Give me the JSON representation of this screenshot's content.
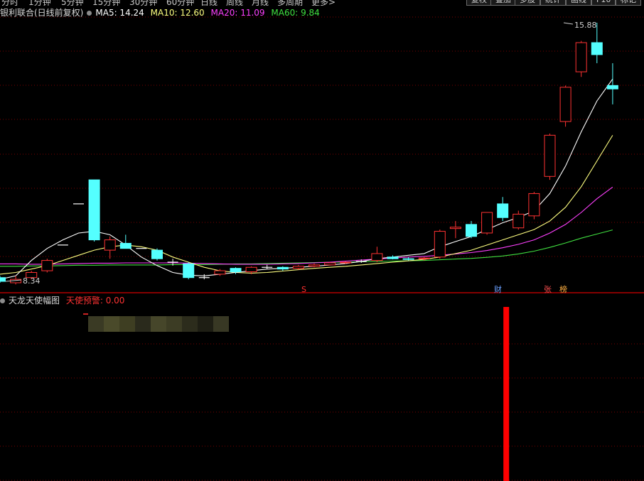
{
  "toolbar": {
    "period_tabs": [
      "分时",
      "1分钟",
      "5分钟",
      "15分钟",
      "30分钟",
      "60分钟",
      "日线",
      "周线",
      "月线",
      "多周期",
      "更多>"
    ],
    "buttons": [
      "复权",
      "叠加",
      "多股",
      "统计",
      "画线",
      "F10",
      "标记"
    ]
  },
  "main_header": {
    "title": "银利联合(日线前复权)",
    "ma5": "MA5: 14.24",
    "ma10": "MA10: 12.60",
    "ma20": "MA20: 11.09",
    "ma60": "MA60: 9.84"
  },
  "indicator_header": {
    "title": "天龙天使幅图",
    "signal": "天使预警: 0.00"
  },
  "chart_markers": {
    "high_label": "15.88",
    "low_label": "8.34",
    "event_s": "S",
    "event_cai": "财",
    "event_zhang": "张",
    "event_bang": "榜"
  },
  "colors": {
    "background": "#000000",
    "up": "#ff3232",
    "down": "#54ffff",
    "ma5": "#ffffff",
    "ma10": "#ffff80",
    "ma20": "#ff40ff",
    "ma60": "#40e040",
    "grid": "#7a0000",
    "signal_bar": "#ff0000"
  },
  "chart_data": {
    "type": "candlestick",
    "y_labels": {
      "high": 15.88,
      "low": 8.34
    },
    "candles": [
      {
        "o": 8.45,
        "c": 8.34,
        "h": 8.5,
        "l": 8.3
      },
      {
        "o": 8.3,
        "c": 8.4,
        "h": 8.5,
        "l": 8.25
      },
      {
        "o": 8.45,
        "c": 8.6,
        "h": 8.65,
        "l": 8.4
      },
      {
        "o": 8.65,
        "c": 8.95,
        "h": 9.0,
        "l": 8.6
      },
      {
        "o": 9.4,
        "c": 9.4,
        "h": 9.4,
        "l": 9.4
      },
      {
        "o": 10.6,
        "c": 10.6,
        "h": 10.6,
        "l": 10.6
      },
      {
        "o": 11.3,
        "c": 9.55,
        "h": 11.3,
        "l": 9.5
      },
      {
        "o": 9.25,
        "c": 9.55,
        "h": 9.65,
        "l": 9.0
      },
      {
        "o": 9.45,
        "c": 9.3,
        "h": 9.7,
        "l": 9.3
      },
      {
        "o": 9.3,
        "c": 9.3,
        "h": 9.3,
        "l": 9.3
      },
      {
        "o": 9.25,
        "c": 9.0,
        "h": 9.3,
        "l": 8.95
      },
      {
        "o": 8.9,
        "c": 8.9,
        "h": 9.0,
        "l": 8.8
      },
      {
        "o": 8.85,
        "c": 8.45,
        "h": 8.9,
        "l": 8.4
      },
      {
        "o": 8.45,
        "c": 8.45,
        "h": 8.55,
        "l": 8.4
      },
      {
        "o": 8.55,
        "c": 8.65,
        "h": 8.7,
        "l": 8.5
      },
      {
        "o": 8.72,
        "c": 8.62,
        "h": 8.75,
        "l": 8.55
      },
      {
        "o": 8.62,
        "c": 8.75,
        "h": 8.78,
        "l": 8.55
      },
      {
        "o": 8.75,
        "c": 8.75,
        "h": 8.82,
        "l": 8.7
      },
      {
        "o": 8.75,
        "c": 8.7,
        "h": 8.78,
        "l": 8.65
      },
      {
        "o": 8.72,
        "c": 8.78,
        "h": 8.82,
        "l": 8.68
      },
      {
        "o": 8.78,
        "c": 8.82,
        "h": 8.86,
        "l": 8.75
      },
      {
        "o": 8.82,
        "c": 8.88,
        "h": 8.9,
        "l": 8.8
      },
      {
        "o": 8.88,
        "c": 8.9,
        "h": 8.92,
        "l": 8.85
      },
      {
        "o": 8.92,
        "c": 8.92,
        "h": 8.98,
        "l": 8.88
      },
      {
        "o": 8.95,
        "c": 9.15,
        "h": 9.35,
        "l": 8.9
      },
      {
        "o": 9.05,
        "c": 9.0,
        "h": 9.1,
        "l": 8.98
      },
      {
        "o": 9.0,
        "c": 8.98,
        "h": 9.05,
        "l": 8.95
      },
      {
        "o": 9.0,
        "c": 9.02,
        "h": 9.05,
        "l": 8.95
      },
      {
        "o": 9.05,
        "c": 9.8,
        "h": 9.85,
        "l": 9.0
      },
      {
        "o": 9.88,
        "c": 9.92,
        "h": 10.1,
        "l": 9.6
      },
      {
        "o": 10.0,
        "c": 9.65,
        "h": 10.1,
        "l": 9.6
      },
      {
        "o": 9.75,
        "c": 10.35,
        "h": 10.35,
        "l": 9.7
      },
      {
        "o": 10.6,
        "c": 10.2,
        "h": 10.8,
        "l": 10.1
      },
      {
        "o": 9.9,
        "c": 10.3,
        "h": 10.4,
        "l": 9.85
      },
      {
        "o": 10.25,
        "c": 10.9,
        "h": 10.95,
        "l": 10.15
      },
      {
        "o": 11.4,
        "c": 12.6,
        "h": 12.65,
        "l": 11.3
      },
      {
        "o": 13.0,
        "c": 14.0,
        "h": 14.05,
        "l": 12.85
      },
      {
        "o": 14.45,
        "c": 15.3,
        "h": 15.35,
        "l": 14.3
      },
      {
        "o": 15.3,
        "c": 14.95,
        "h": 15.88,
        "l": 14.7
      },
      {
        "o": 14.05,
        "c": 13.95,
        "h": 14.7,
        "l": 13.5
      }
    ],
    "ma5": [
      8.4,
      8.5,
      8.95,
      9.3,
      9.55,
      9.75,
      9.8,
      9.7,
      9.4,
      9.05,
      8.8,
      8.6,
      8.52,
      8.5,
      8.55,
      8.6,
      8.65,
      8.7,
      8.72,
      8.75,
      8.78,
      8.82,
      8.86,
      8.92,
      9.0,
      9.05,
      9.1,
      9.15,
      9.35,
      9.5,
      9.65,
      9.85,
      10.05,
      10.2,
      10.4,
      10.9,
      11.7,
      12.7,
      13.6,
      14.24
    ],
    "ma10": [
      8.55,
      8.6,
      8.7,
      8.8,
      8.95,
      9.1,
      9.25,
      9.35,
      9.4,
      9.35,
      9.25,
      9.05,
      8.9,
      8.75,
      8.65,
      8.6,
      8.58,
      8.6,
      8.64,
      8.68,
      8.72,
      8.75,
      8.78,
      8.82,
      8.86,
      8.9,
      8.94,
      8.98,
      9.05,
      9.15,
      9.25,
      9.4,
      9.55,
      9.7,
      9.85,
      10.1,
      10.5,
      11.1,
      11.85,
      12.6
    ],
    "ma20": [
      8.85,
      8.85,
      8.84,
      8.84,
      8.85,
      8.86,
      8.87,
      8.87,
      8.88,
      8.88,
      8.88,
      8.88,
      8.87,
      8.86,
      8.85,
      8.84,
      8.84,
      8.84,
      8.85,
      8.86,
      8.88,
      8.9,
      8.93,
      8.96,
      8.99,
      9.02,
      9.05,
      9.07,
      9.1,
      9.14,
      9.18,
      9.24,
      9.32,
      9.42,
      9.55,
      9.75,
      10.0,
      10.35,
      10.75,
      11.09
    ],
    "ma60": [
      8.78,
      8.78,
      8.79,
      8.79,
      8.8,
      8.81,
      8.81,
      8.82,
      8.82,
      8.82,
      8.82,
      8.83,
      8.83,
      8.83,
      8.84,
      8.85,
      8.85,
      8.86,
      8.87,
      8.88,
      8.89,
      8.9,
      8.9,
      8.91,
      8.92,
      8.93,
      8.94,
      8.95,
      8.97,
      8.99,
      9.01,
      9.04,
      9.08,
      9.14,
      9.22,
      9.33,
      9.46,
      9.6,
      9.72,
      9.84
    ],
    "signal": {
      "bar_index": 31,
      "level": 0.85
    }
  }
}
